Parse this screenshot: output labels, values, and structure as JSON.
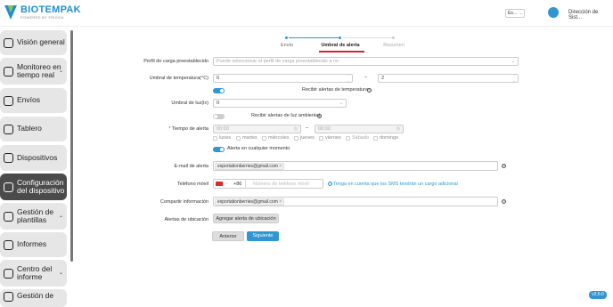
{
  "brand": {
    "title": "BIOTEMPAK",
    "subtitle": "POWERED BY FRIGGA"
  },
  "header": {
    "language": "Es...",
    "user": "Dirección de Sist..."
  },
  "sidebar": {
    "items": [
      {
        "label": "Visión general",
        "icon": "home-icon"
      },
      {
        "label": "Monitoreo en tiempo real",
        "icon": "people-icon"
      },
      {
        "label": "Envíos",
        "icon": "box-icon"
      },
      {
        "label": "Tablero",
        "icon": "dashboard-icon"
      },
      {
        "label": "Dispositivos",
        "icon": "check-icon"
      },
      {
        "label": "Configuración del dispositivo",
        "icon": "device-icon",
        "active": true
      },
      {
        "label": "Gestión de plantillas",
        "icon": "template-icon"
      },
      {
        "label": "Informes",
        "icon": "chart-icon"
      },
      {
        "label": "Centro del informe",
        "icon": "report-icon"
      },
      {
        "label": "Gestión de",
        "icon": "manage-icon"
      }
    ]
  },
  "steps": [
    {
      "label": "Envío"
    },
    {
      "label": "Umbral de alerta",
      "active": true
    },
    {
      "label": "Resumen"
    }
  ],
  "form": {
    "profile_label": "Perfil de carga preestablecido",
    "profile_placeholder": "Puede seleccionar el perfil de carga preestablecido a no",
    "temp_label": "Umbral de temperatura(°C)",
    "temp_min": "0",
    "temp_max": "2",
    "temp_dash": "–",
    "temp_alert_label": "Recibir alertas de temperatura",
    "light_label": "Umbral de luz(lx)",
    "light_value": "0",
    "light_alert_label": "Recibir alertas de luz ambiental",
    "alert_time_label": "Tiempo de alerta",
    "alert_time_required": "*",
    "time_start": "00:00",
    "time_end": "00:00",
    "time_dash": "–",
    "days": [
      "lunes",
      "martes",
      "miércoles",
      "jueves",
      "viernes",
      "Sábado",
      "domingo"
    ],
    "any_time_label": "Alerta en cualquier momento",
    "email_label": "E-mail de alerta",
    "email_tag": "exportationberries@gmail.com",
    "phone_label": "Teléfono móvil",
    "phone_code": "+86",
    "phone_placeholder": "Número de teléfono móvil",
    "sms_note": "Tenga en cuenta que los SMS tendrán un cargo adicional",
    "share_label": "Compartir información",
    "share_tag": "exportationberries@gmail.com",
    "location_label": "Alertas de ubicación",
    "location_button": "Agregar alerta de ubicación",
    "prev_button": "Anterior",
    "next_button": "Siguiente"
  },
  "version": "v2.6.0",
  "colors": {
    "accent": "#2f96d3",
    "active_step": "#d9232d",
    "sidebar_active": "#4b4b4b"
  }
}
